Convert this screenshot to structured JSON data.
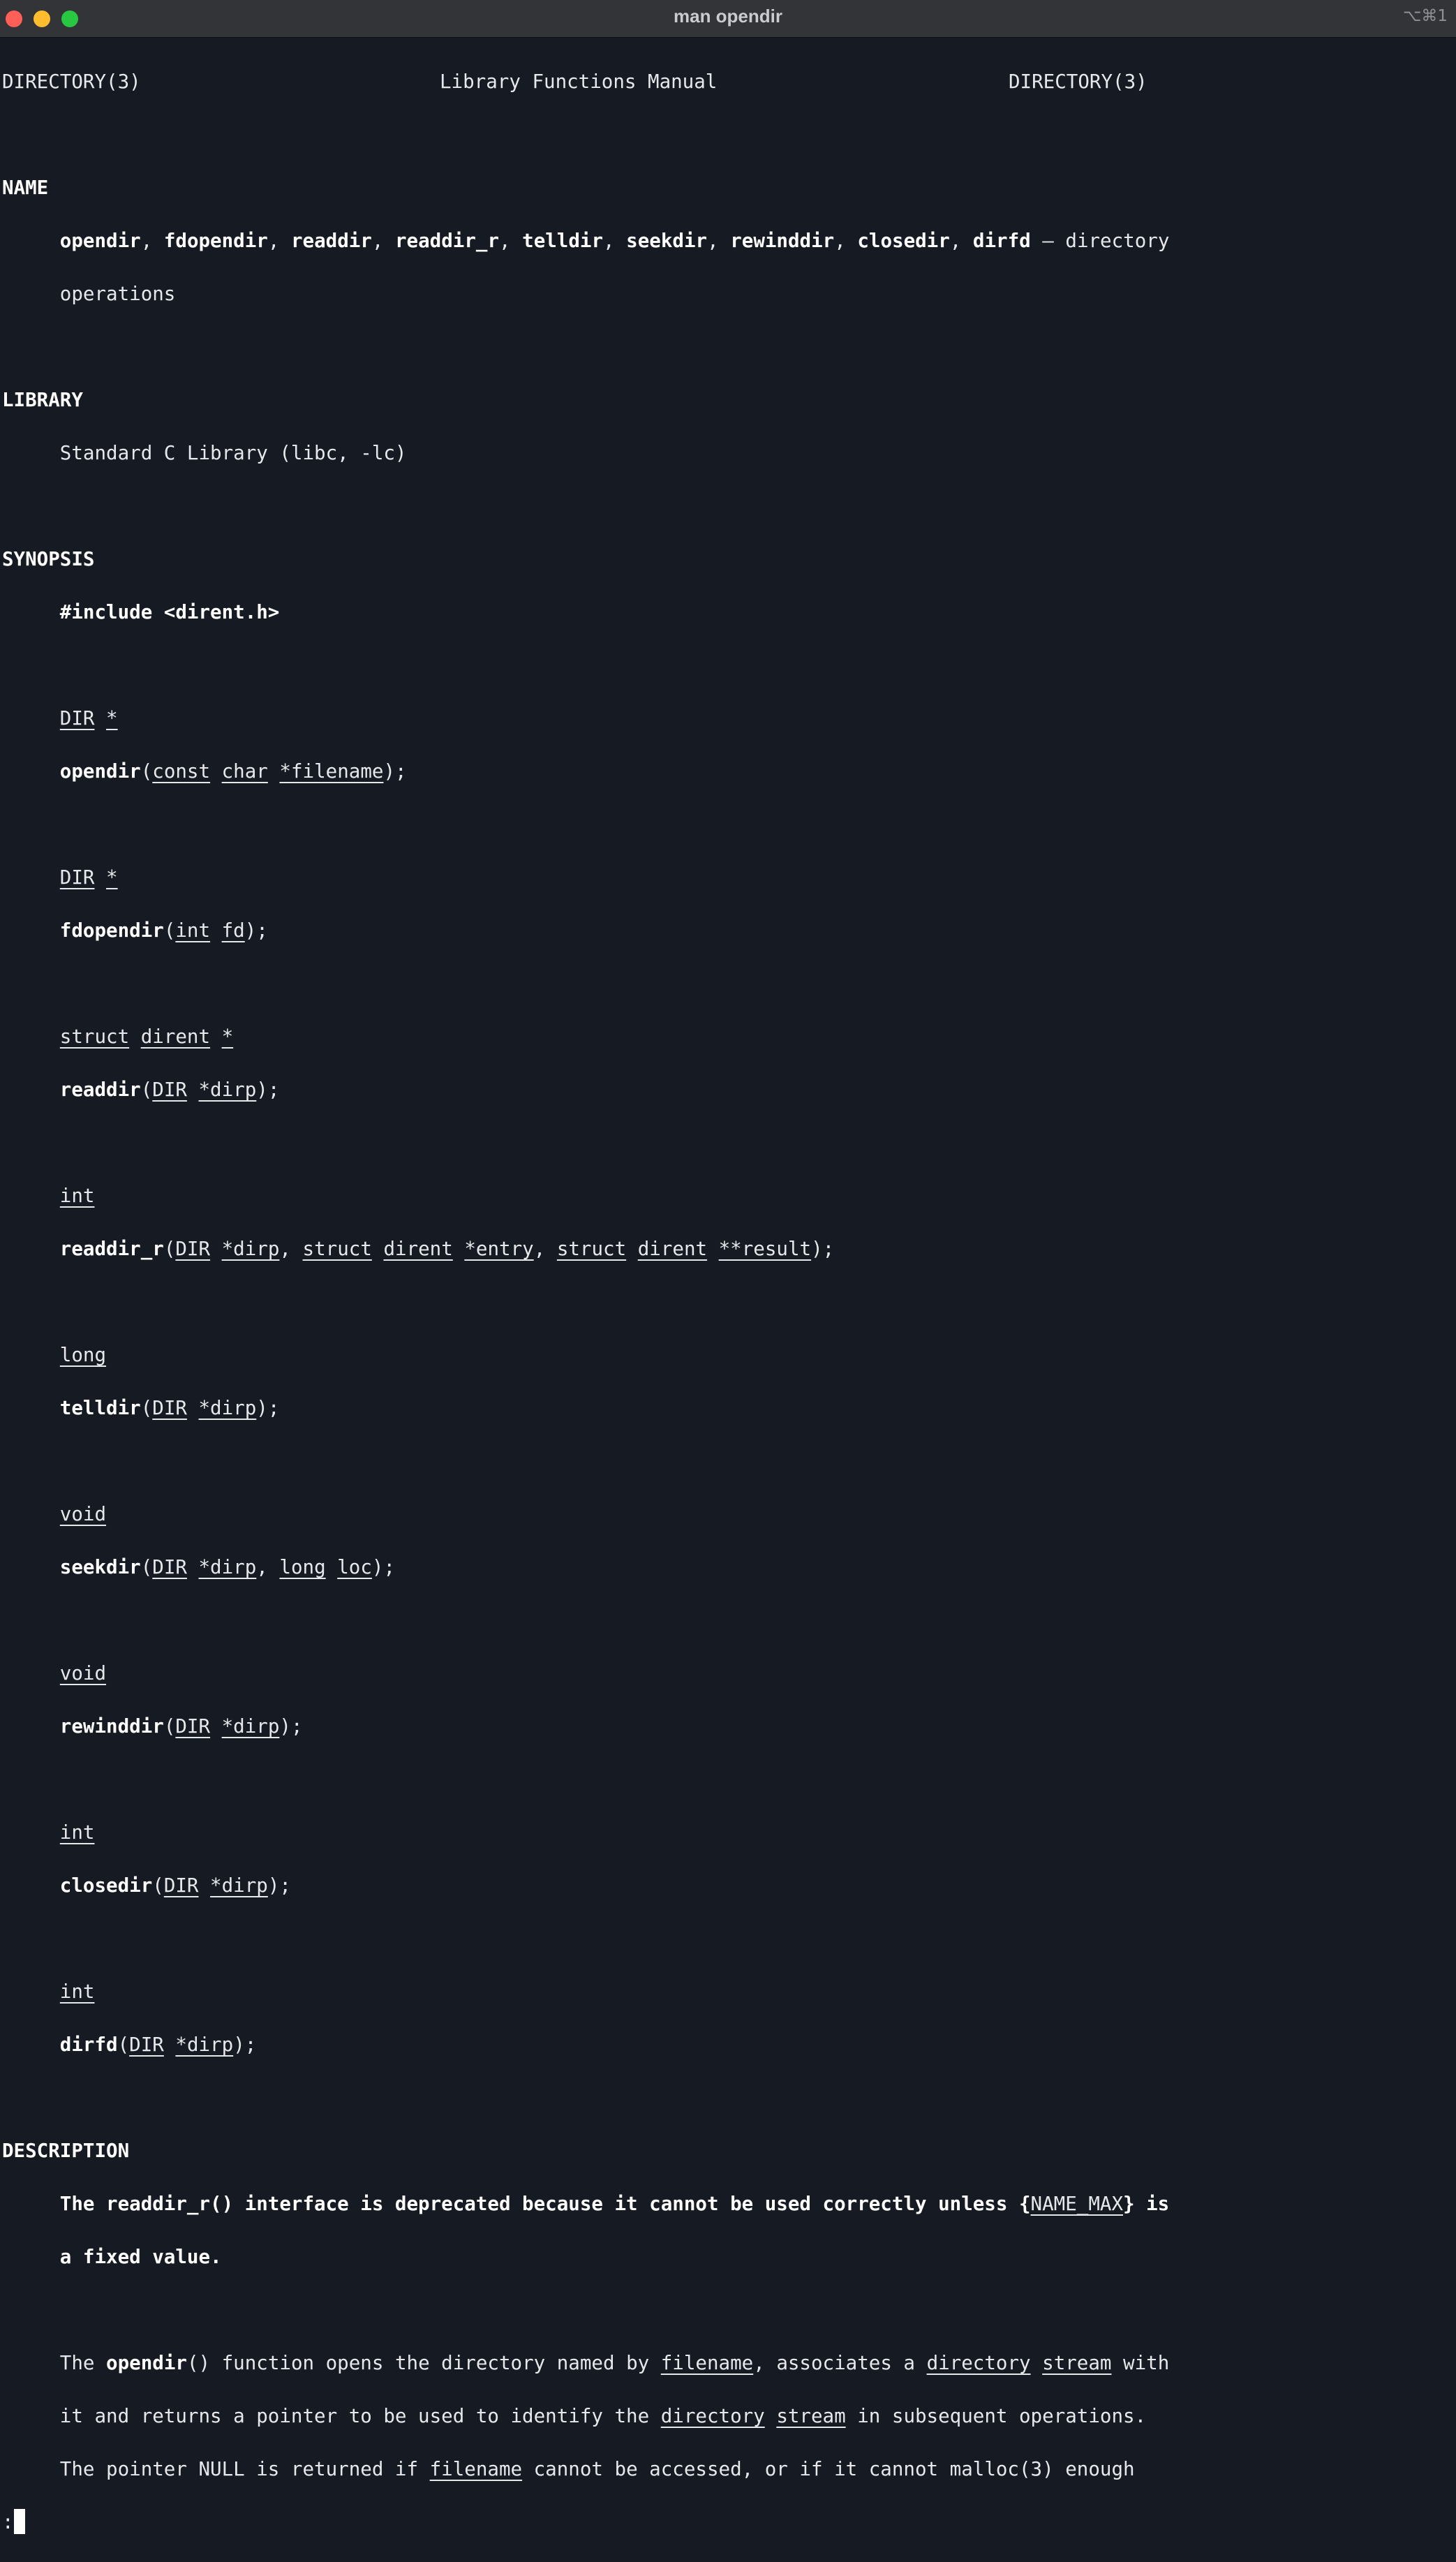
{
  "window": {
    "title": "man opendir",
    "shortcut": "⌥⌘1"
  },
  "man": {
    "header_left": "DIRECTORY(3)",
    "header_center": "Library Functions Manual",
    "header_right": "DIRECTORY(3)",
    "sections": {
      "name": "NAME",
      "library": "LIBRARY",
      "synopsis": "SYNOPSIS",
      "description": "DESCRIPTION"
    },
    "name_functions": [
      "opendir",
      "fdopendir",
      "readdir",
      "readdir_r",
      "telldir",
      "seekdir",
      "rewinddir",
      "closedir",
      "dirfd"
    ],
    "name_desc_1": "directory",
    "name_desc_2": "operations",
    "library_text": "Standard C Library (libc, -lc)",
    "include": "#include <dirent.h>",
    "description": {
      "deprecation_1": "The readdir_r() interface is deprecated because it cannot be used correctly unless {",
      "name_max": "NAME_MAX",
      "deprecation_2": "} is",
      "deprecation_3": "a fixed value.",
      "p1_a": "The ",
      "p1_fn": "opendir",
      "p1_b": "() function opens the directory named by ",
      "p1_c": ", associates a ",
      "p1_d": " with",
      "p2_a": "it and returns a pointer to be used to identify the ",
      "p2_b": " in subsequent operations.",
      "p3_a": "The pointer NULL is returned if ",
      "p3_b": " cannot be accessed, or if it cannot malloc(3) enough"
    }
  },
  "prompt": ":"
}
